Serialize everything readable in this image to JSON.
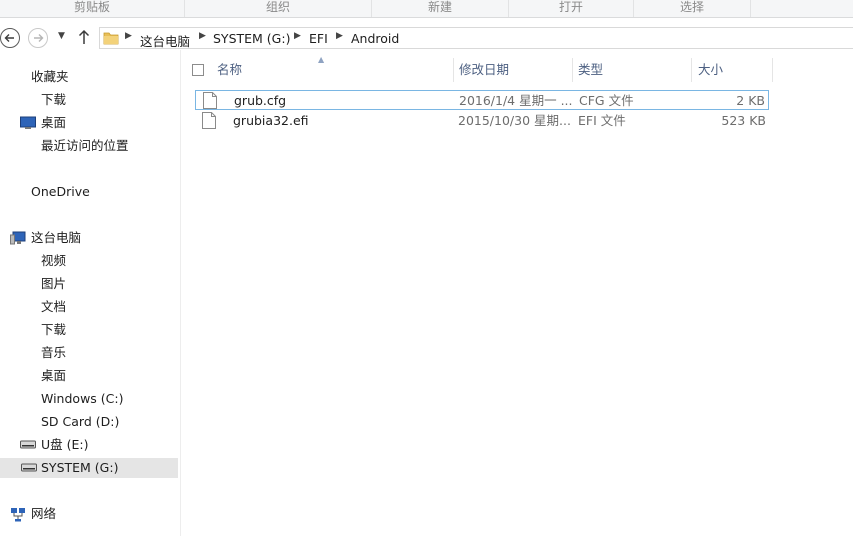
{
  "ribbon": {
    "groups": [
      "剪贴板",
      "组织",
      "新建",
      "打开",
      "选择"
    ]
  },
  "address": {
    "crumbs": [
      "这台电脑",
      "SYSTEM (G:)",
      "EFI",
      "Android"
    ]
  },
  "icons": {
    "back": "back-arrow-icon",
    "forward": "forward-arrow-icon",
    "recent": "chevron-down-icon",
    "up": "up-arrow-icon",
    "folder": "folder-icon",
    "file": "file-icon"
  },
  "sidebar": {
    "favorites_header": "收藏夹",
    "favorites": [
      "下载",
      "桌面",
      "最近访问的位置"
    ],
    "onedrive": "OneDrive",
    "thispc_header": "这台电脑",
    "thispc_items": [
      "视频",
      "图片",
      "文档",
      "下载",
      "音乐",
      "桌面",
      "Windows (C:)",
      "SD Card (D:)",
      "U盘 (E:)",
      "SYSTEM (G:)"
    ],
    "network": "网络",
    "selected": "SYSTEM (G:)"
  },
  "columns": {
    "name": "名称",
    "date": "修改日期",
    "type": "类型",
    "size": "大小"
  },
  "files": [
    {
      "name": "grub.cfg",
      "date": "2016/1/4 星期一 ...",
      "type": "CFG 文件",
      "size": "2 KB"
    },
    {
      "name": "grubia32.efi",
      "date": "2015/10/30 星期...",
      "type": "EFI 文件",
      "size": "523 KB"
    }
  ],
  "colors": {
    "header_text": "#4d6082",
    "selection_bg": "#e5e5e5",
    "focus_border": "#7ab6e3"
  }
}
